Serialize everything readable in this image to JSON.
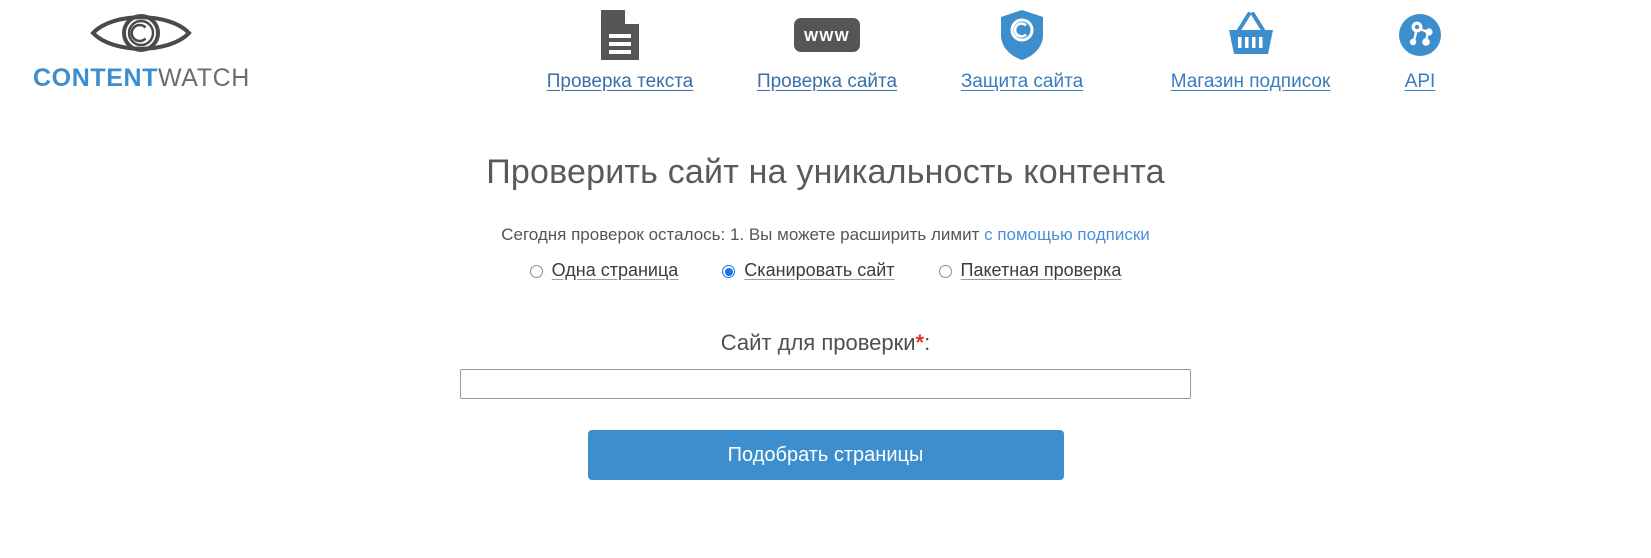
{
  "brand": {
    "name_primary": "CONTENT",
    "name_secondary": "WATCH",
    "logo_icon": "eye-copyright-icon",
    "primary_color": "#3d8ecc",
    "secondary_color": "#6d6d6d"
  },
  "nav": {
    "items": [
      {
        "label": "Проверка текста",
        "icon": "document-icon",
        "icon_color": "#555555"
      },
      {
        "label": "Проверка сайта",
        "icon": "www-icon",
        "icon_color": "#555555"
      },
      {
        "label": "Защита сайта",
        "icon": "shield-copyright-icon",
        "icon_color": "#3d8ecc"
      },
      {
        "label": "Магазин подписок",
        "icon": "basket-icon",
        "icon_color": "#3d8ecc"
      },
      {
        "label": "API",
        "icon": "api-nodes-icon",
        "icon_color": "#3d8ecc"
      }
    ]
  },
  "main": {
    "heading": "Проверить сайт на уникальность контента",
    "limit_text": "Сегодня проверок осталось: 1. Вы можете расширить лимит ",
    "limit_link": "с помощью подписки",
    "modes": [
      {
        "label": "Одна страница",
        "selected": false
      },
      {
        "label": "Сканировать сайт",
        "selected": true
      },
      {
        "label": "Пакетная проверка",
        "selected": false
      }
    ],
    "field_label": "Сайт для проверки",
    "field_required_mark": "*",
    "field_label_colon": ":",
    "url_value": "",
    "url_placeholder": "",
    "submit_label": "Подобрать страницы",
    "submit_color": "#3d8ecc",
    "required_color": "#e2342b"
  }
}
